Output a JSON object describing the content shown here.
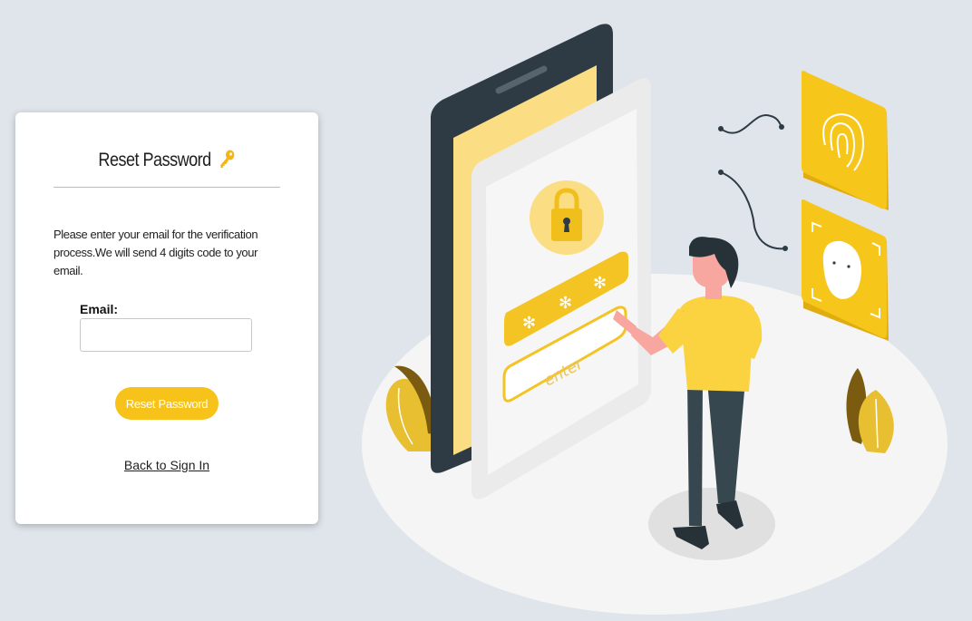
{
  "form": {
    "title": "Reset Password",
    "title_icon": "key-icon",
    "description": "Please enter your email for the verification process.We will send 4 digits code to your email.",
    "email_label": "Email:",
    "email_value": "",
    "email_placeholder": "",
    "submit_label": "Reset Password",
    "back_link": "Back to Sign In"
  },
  "illustration": {
    "screen_button_label": "enter",
    "icons": [
      "padlock-icon",
      "fingerprint-icon",
      "face-id-icon"
    ]
  },
  "colors": {
    "background": "#dfe5eb",
    "accent": "#f7c31b",
    "card": "#ffffff"
  }
}
